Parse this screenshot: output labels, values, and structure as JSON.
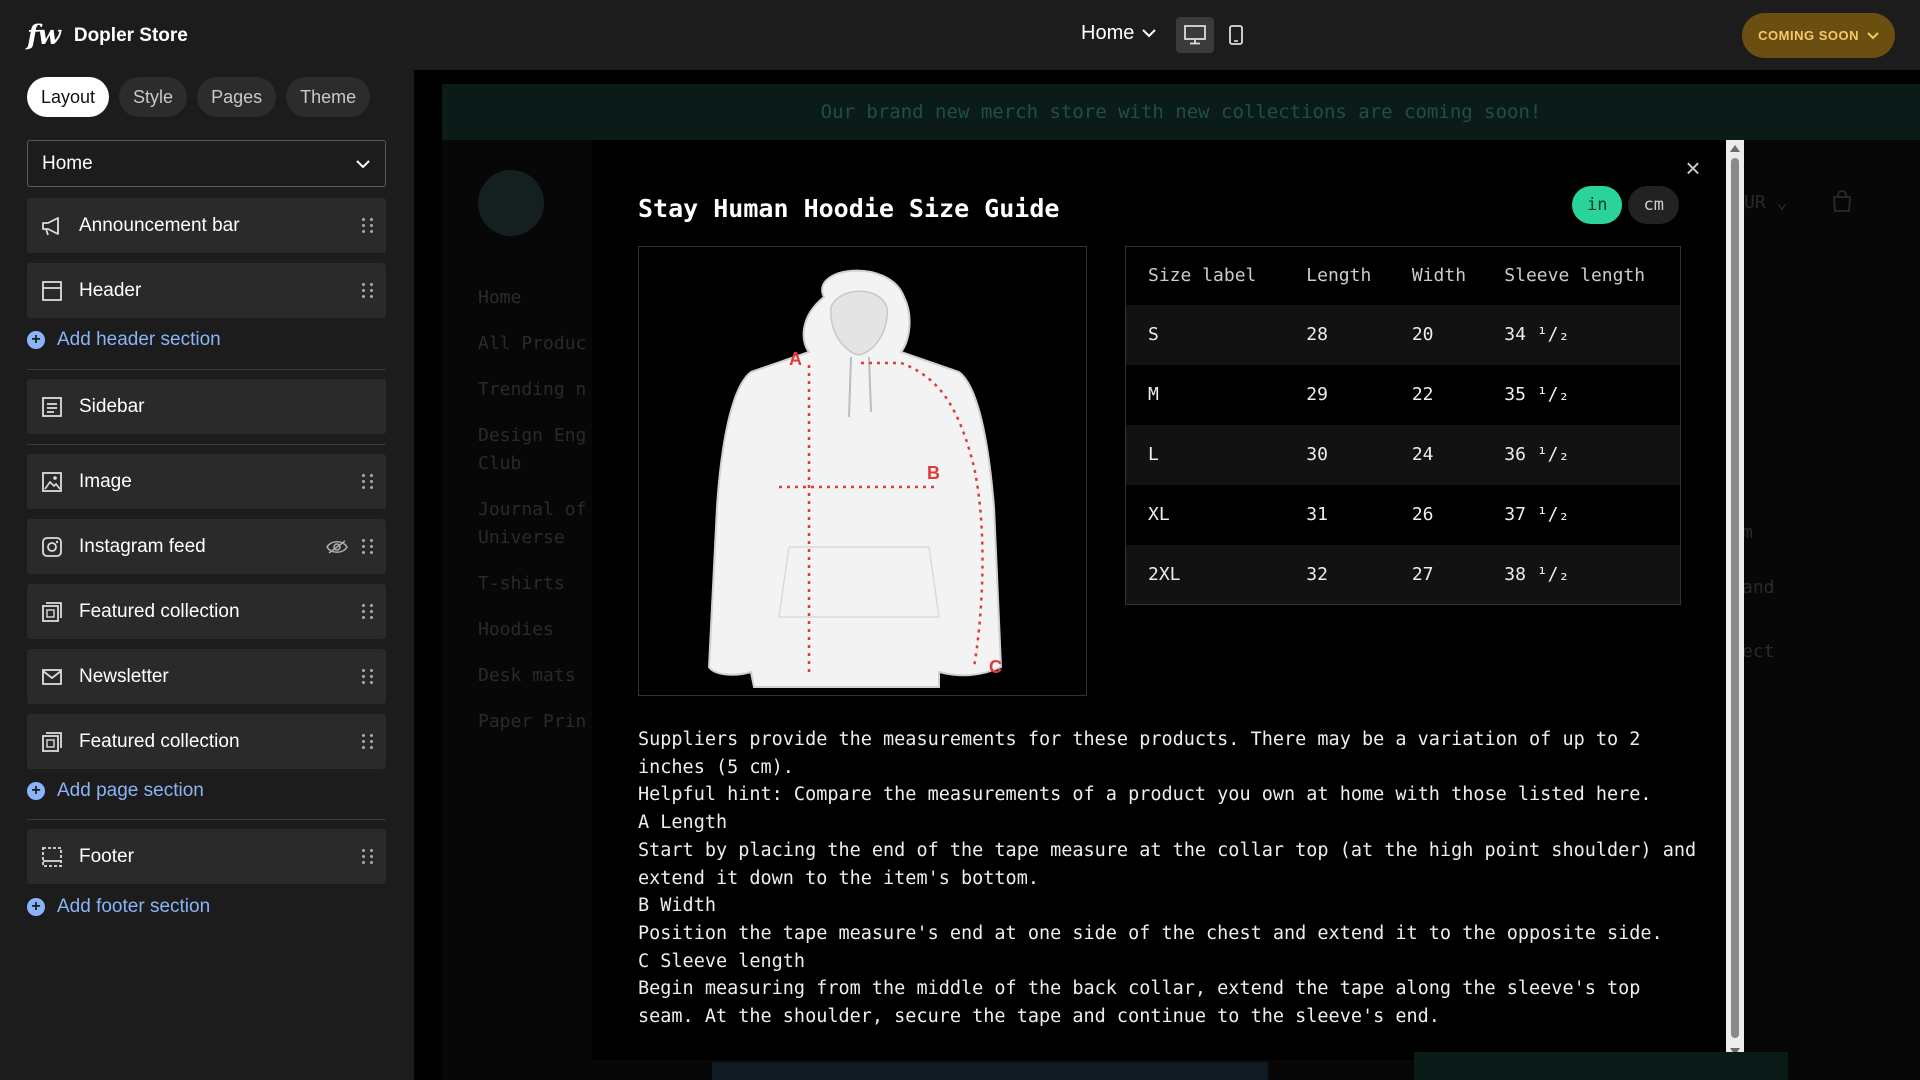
{
  "app": {
    "logo_text": "fw",
    "store_name": "Dopler Store"
  },
  "tabs": [
    {
      "label": "Layout",
      "active": true
    },
    {
      "label": "Style",
      "active": false
    },
    {
      "label": "Pages",
      "active": false
    },
    {
      "label": "Theme",
      "active": false
    }
  ],
  "page_selector": {
    "value": "Home"
  },
  "sections": [
    {
      "label": "Announcement bar",
      "icon": "megaphone-icon"
    },
    {
      "label": "Header",
      "icon": "header-layout-icon"
    },
    {
      "label": "Sidebar",
      "icon": "sidebar-layout-icon"
    },
    {
      "label": "Image",
      "icon": "image-icon"
    },
    {
      "label": "Instagram feed",
      "icon": "instagram-icon",
      "hidden_toggle": true
    },
    {
      "label": "Featured collection",
      "icon": "collection-icon"
    },
    {
      "label": "Newsletter",
      "icon": "mail-icon"
    },
    {
      "label": "Featured collection",
      "icon": "collection-icon"
    },
    {
      "label": "Footer",
      "icon": "footer-layout-icon"
    }
  ],
  "add_links": {
    "header": "Add header section",
    "page": "Add page section",
    "footer": "Add footer section"
  },
  "topbar": {
    "page": "Home",
    "status_button": "COMING SOON"
  },
  "preview": {
    "announcement": "Our brand new merch store with new collections are coming soon!",
    "nav": [
      "Home",
      "All Produc",
      "Trending n",
      "Design Eng Club",
      "Journal of Universe",
      "T-shirts",
      "Hoodies",
      "Desk mats",
      "Paper Prin"
    ],
    "ghost_right": [
      "UR",
      "m",
      "and",
      "ect"
    ]
  },
  "modal": {
    "title": "Stay Human Hoodie Size Guide",
    "units": [
      {
        "label": "in",
        "active": true
      },
      {
        "label": "cm",
        "active": false
      }
    ],
    "diagram_labels": [
      "A",
      "B",
      "C"
    ],
    "table": {
      "headers": [
        "Size label",
        "Length",
        "Width",
        "Sleeve length"
      ],
      "rows": [
        [
          "S",
          "28",
          "20",
          "34 ¹/₂"
        ],
        [
          "M",
          "29",
          "22",
          "35 ¹/₂"
        ],
        [
          "L",
          "30",
          "24",
          "36 ¹/₂"
        ],
        [
          "XL",
          "31",
          "26",
          "37 ¹/₂"
        ],
        [
          "2XL",
          "32",
          "27",
          "38 ¹/₂"
        ]
      ]
    },
    "description": [
      "Suppliers provide the measurements for these products. There may be a variation of up to 2 inches (5 cm).",
      "Helpful hint: Compare the measurements of a product you own at home with those listed here.",
      "A Length",
      "Start by placing the end of the tape measure at the collar top (at the high point shoulder) and extend it down to the item's bottom.",
      "B Width",
      "Position the tape measure's end at one side of the chest and extend it to the opposite side.",
      "C Sleeve length",
      "Begin measuring from the middle of the back collar, extend the tape along the sleeve's top seam. At the shoulder, secure the tape and continue to the sleeve's end."
    ]
  },
  "colors": {
    "accent_blue": "#8ab4f8",
    "unit_active": "#2ad39b",
    "coming_soon_bg": "#6b4f10",
    "coming_soon_text": "#f5c86a",
    "measure_red": "#e03a3a"
  }
}
